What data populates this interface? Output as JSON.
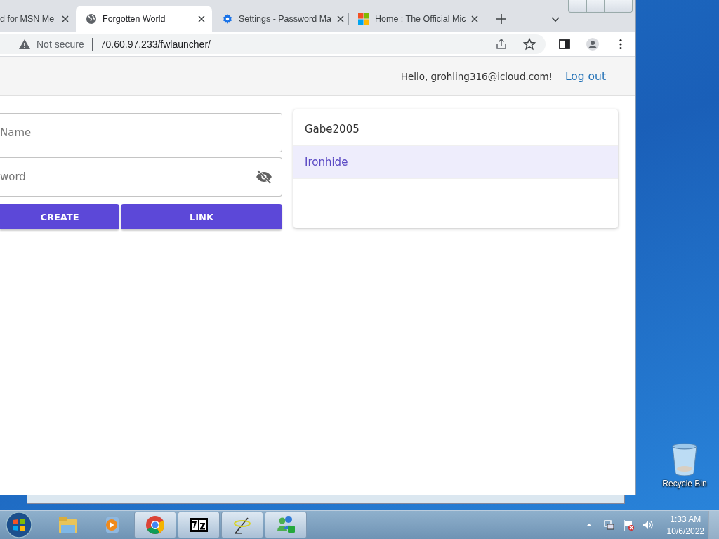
{
  "browser": {
    "tabs": [
      {
        "title": "d for MSN Me",
        "kind": "none",
        "selected": false
      },
      {
        "title": "Forgotten World",
        "kind": "globe",
        "selected": true
      },
      {
        "title": "Settings - Password Ma",
        "kind": "gear",
        "selected": false
      },
      {
        "title": "Home : The Official Mic",
        "kind": "tiles",
        "selected": false
      }
    ],
    "address": {
      "security": "Not secure",
      "url": "70.60.97.233/fwlauncher/"
    }
  },
  "page": {
    "greeting": "Hello, grohling316@icloud.com!",
    "logout": "Log out",
    "fields": [
      {
        "placeholder": "Name",
        "kind": "text"
      },
      {
        "placeholder": "word",
        "kind": "password"
      }
    ],
    "buttons": [
      "CREATE",
      "LINK"
    ],
    "accounts": [
      {
        "name": "Gabe2005",
        "selected": false
      },
      {
        "name": "Ironhide",
        "selected": true
      }
    ]
  },
  "desktop": {
    "icons": [
      {
        "label": "Recycle Bin"
      }
    ]
  },
  "taskbar": {
    "apps": [
      {
        "kind": "explorer",
        "running": false
      },
      {
        "kind": "media",
        "running": false
      },
      {
        "kind": "chrome",
        "running": true
      },
      {
        "kind": "archiver",
        "running": true
      },
      {
        "kind": "wand",
        "running": true
      },
      {
        "kind": "messenger",
        "running": true
      }
    ],
    "time": "1:33 AM",
    "date": "10/6/2022"
  }
}
